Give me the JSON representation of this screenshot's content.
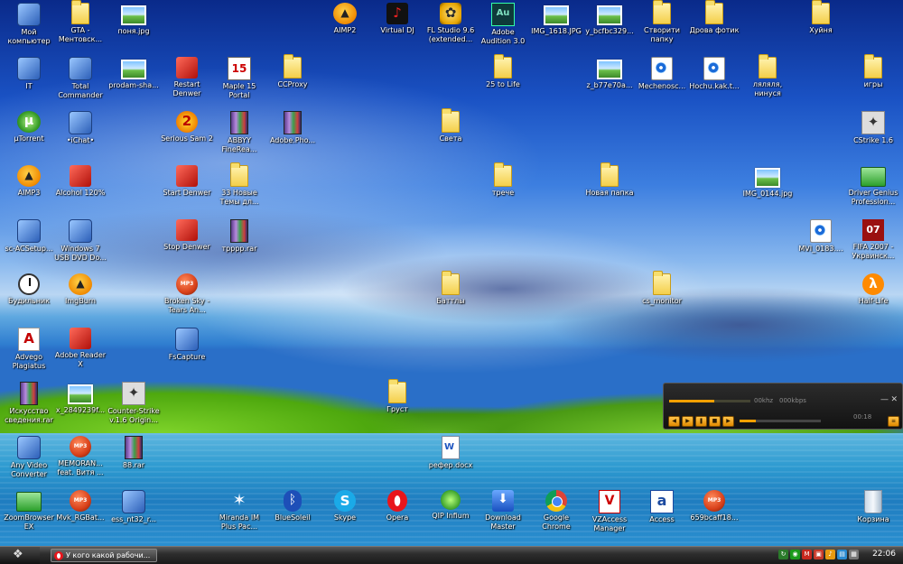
{
  "desktop_icons": [
    {
      "label": "Мой\nкомпьютер",
      "icon": "computer-icon",
      "kind": "app",
      "col": 0,
      "row": 0
    },
    {
      "label": "GTA -\nМентовск...",
      "icon": "folder-icon",
      "kind": "folder",
      "col": 1,
      "row": 0
    },
    {
      "label": "поня.jpg",
      "icon": "image-file-icon",
      "kind": "image",
      "col": 2,
      "row": 0
    },
    {
      "label": "AIMP2",
      "icon": "aimp-icon",
      "kind": "aimp",
      "col": 6,
      "row": 0
    },
    {
      "label": "Virtual DJ",
      "icon": "virtual-dj-icon",
      "kind": "dj",
      "col": 7,
      "row": 0
    },
    {
      "label": "FL Studio 9.6\n(extended...",
      "icon": "fl-studio-icon",
      "kind": "fl",
      "col": 8,
      "row": 0
    },
    {
      "label": "Adobe\nAudition 3.0",
      "icon": "adobe-audition-icon",
      "kind": "au",
      "col": 9,
      "row": 0
    },
    {
      "label": "IMG_1618.JPG",
      "icon": "image-file-icon",
      "kind": "image",
      "col": 10,
      "row": 0
    },
    {
      "label": "y_bcfbc329...",
      "icon": "image-file-icon",
      "kind": "image",
      "col": 11,
      "row": 0
    },
    {
      "label": "Створити\nпапку",
      "icon": "folder-icon",
      "kind": "folder",
      "col": 12,
      "row": 0
    },
    {
      "label": "Дрова фотик",
      "icon": "folder-icon",
      "kind": "folder",
      "col": 13,
      "row": 0
    },
    {
      "label": "Хуйня",
      "icon": "folder-icon",
      "kind": "folder",
      "col": 15,
      "row": 0
    },
    {
      "label": "IT",
      "icon": "network-computer-icon",
      "kind": "app",
      "col": 0,
      "row": 1
    },
    {
      "label": "Total\nCommander",
      "icon": "floppy-icon",
      "kind": "app",
      "col": 1,
      "row": 1
    },
    {
      "label": "prodam-sha...",
      "icon": "image-file-icon",
      "kind": "image",
      "col": 2,
      "row": 1
    },
    {
      "label": "Restart\nDenwer",
      "icon": "denwer-icon",
      "kind": "red",
      "col": 3,
      "row": 1
    },
    {
      "label": "Maple 15\nPortal",
      "icon": "maple-icon",
      "kind": "maple",
      "col": 4,
      "row": 1
    },
    {
      "label": "CCProxy",
      "icon": "folder-icon",
      "kind": "folder",
      "col": 5,
      "row": 1
    },
    {
      "label": "25 to Life",
      "icon": "folder-icon",
      "kind": "folder",
      "col": 9,
      "row": 1
    },
    {
      "label": "z_b77e70a...",
      "icon": "image-file-icon",
      "kind": "image",
      "col": 11,
      "row": 1
    },
    {
      "label": "Mechenosc...",
      "icon": "video-file-icon",
      "kind": "video",
      "col": 12,
      "row": 1
    },
    {
      "label": "Hochu.kak.t...",
      "icon": "video-file-icon",
      "kind": "video",
      "col": 13,
      "row": 1
    },
    {
      "label": "ляляля,\nнинуся",
      "icon": "folder-icon",
      "kind": "folder",
      "col": 14,
      "row": 1
    },
    {
      "label": "игры",
      "icon": "folder-icon",
      "kind": "folder",
      "col": 16,
      "row": 1
    },
    {
      "label": "µTorrent",
      "icon": "utorrent-icon",
      "kind": "utorrent",
      "col": 0,
      "row": 2
    },
    {
      "label": "•iChat•",
      "icon": "phone-icon",
      "kind": "app",
      "col": 1,
      "row": 2
    },
    {
      "label": "Serious Sam 2",
      "icon": "serious-sam-icon",
      "kind": "sam",
      "col": 3,
      "row": 2
    },
    {
      "label": "ABBYY\nFineRea...",
      "icon": "document-icon",
      "kind": "rar",
      "col": 4,
      "row": 2
    },
    {
      "label": "Adobe.Pho...",
      "icon": "archive-icon",
      "kind": "rar",
      "col": 5,
      "row": 2
    },
    {
      "label": "Света",
      "icon": "folder-icon",
      "kind": "folder",
      "col": 8,
      "row": 2
    },
    {
      "label": "CStrike 1.6",
      "icon": "counter-strike-icon",
      "kind": "cs",
      "col": 16,
      "row": 2
    },
    {
      "label": "AIMP3",
      "icon": "aimp-icon",
      "kind": "aimp",
      "col": 0,
      "row": 3
    },
    {
      "label": "Alcohol 120%",
      "icon": "alcohol-icon",
      "kind": "red",
      "col": 1,
      "row": 3
    },
    {
      "label": "Start Denwer",
      "icon": "denwer-icon",
      "kind": "red",
      "col": 3,
      "row": 3
    },
    {
      "label": "33 Новые\nТемы дл...",
      "icon": "folder-icon",
      "kind": "folder",
      "col": 4,
      "row": 3
    },
    {
      "label": "трече",
      "icon": "folder-icon",
      "kind": "folder",
      "col": 9,
      "row": 3
    },
    {
      "label": "Новая папка",
      "icon": "folder-icon",
      "kind": "folder",
      "col": 11,
      "row": 3
    },
    {
      "label": "IMG_0144.jpg",
      "icon": "image-file-icon",
      "kind": "image",
      "col": 14,
      "row": 3
    },
    {
      "label": "Driver Genius\nProfession...",
      "icon": "driver-genius-icon",
      "kind": "net",
      "col": 16,
      "row": 3
    },
    {
      "label": "sc-ACSetup...",
      "icon": "satellite-icon",
      "kind": "app",
      "col": 0,
      "row": 4
    },
    {
      "label": "Windows 7\nUSB DVD Do...",
      "icon": "usb-icon",
      "kind": "app",
      "col": 1,
      "row": 4
    },
    {
      "label": "Stop Denwer",
      "icon": "denwer-icon",
      "kind": "red",
      "col": 3,
      "row": 4
    },
    {
      "label": "трррр.rar",
      "icon": "archive-icon",
      "kind": "rar",
      "col": 4,
      "row": 4
    },
    {
      "label": "MVI_0183....",
      "icon": "video-file-icon",
      "kind": "video",
      "col": 15,
      "row": 4
    },
    {
      "label": "FIFA 2007 -\nУкраинск...",
      "icon": "fifa-icon",
      "kind": "fifa",
      "col": 16,
      "row": 4
    },
    {
      "label": "Будильник",
      "icon": "clock-icon",
      "kind": "clock",
      "col": 0,
      "row": 5
    },
    {
      "label": "ImgBurn",
      "icon": "imgburn-icon",
      "kind": "aimp",
      "col": 1,
      "row": 5
    },
    {
      "label": "Broken Sky -\nTears An...",
      "icon": "mp3-icon",
      "kind": "mp3",
      "col": 3,
      "row": 5
    },
    {
      "label": "Баттлы",
      "icon": "folder-icon",
      "kind": "folder",
      "col": 8,
      "row": 5
    },
    {
      "label": "cs_monitor",
      "icon": "folder-icon",
      "kind": "folder",
      "col": 12,
      "row": 5
    },
    {
      "label": "Half-Life",
      "icon": "half-life-icon",
      "kind": "hl",
      "col": 16,
      "row": 5
    },
    {
      "label": "Advego\nPlagiatus",
      "icon": "advego-icon",
      "kind": "adobe",
      "col": 0,
      "row": 6
    },
    {
      "label": "Adobe Reader\nX",
      "icon": "adobe-reader-icon",
      "kind": "red",
      "col": 1,
      "row": 6
    },
    {
      "label": "FsCapture",
      "icon": "fscapture-icon",
      "kind": "app",
      "col": 3,
      "row": 6
    },
    {
      "label": "Искусство\nсведения.rar",
      "icon": "archive-icon",
      "kind": "rar",
      "col": 0,
      "row": 7
    },
    {
      "label": "x_2849239f...",
      "icon": "image-file-icon",
      "kind": "image",
      "col": 1,
      "row": 7
    },
    {
      "label": "Counter-Strike\nv.1.6 Origin...",
      "icon": "counter-strike-icon",
      "kind": "cs",
      "col": 2,
      "row": 7
    },
    {
      "label": "Груст",
      "icon": "folder-icon",
      "kind": "folder",
      "col": 7,
      "row": 7
    },
    {
      "label": "Any Video\nConverter",
      "icon": "video-converter-icon",
      "kind": "app",
      "col": 0,
      "row": 8
    },
    {
      "label": "MEMORAN...\nfeat. Витя ...",
      "icon": "mp3-icon",
      "kind": "mp3",
      "col": 1,
      "row": 8
    },
    {
      "label": "88.rar",
      "icon": "archive-icon",
      "kind": "rar",
      "col": 2,
      "row": 8
    },
    {
      "label": "рефер.docx",
      "icon": "word-document-icon",
      "kind": "doc",
      "col": 8,
      "row": 8
    },
    {
      "label": "ZoomBrowser\nEX",
      "icon": "zoombrowser-icon",
      "kind": "net",
      "col": 0,
      "row": 9
    },
    {
      "label": "Mvk_RGBat...",
      "icon": "mp3-icon",
      "kind": "mp3",
      "col": 1,
      "row": 9
    },
    {
      "label": "ess_nt32_r...",
      "icon": "installer-icon",
      "kind": "app",
      "col": 2,
      "row": 9
    },
    {
      "label": "Miranda IM\nPlus Pac...",
      "icon": "miranda-icon",
      "kind": "miranda",
      "col": 4,
      "row": 9
    },
    {
      "label": "BlueSoleil",
      "icon": "bluetooth-icon",
      "kind": "bt",
      "col": 5,
      "row": 9
    },
    {
      "label": "Skype",
      "icon": "skype-icon",
      "kind": "skype",
      "col": 6,
      "row": 9
    },
    {
      "label": "Opera",
      "icon": "opera-icon",
      "kind": "opera",
      "col": 7,
      "row": 9
    },
    {
      "label": "QIP Infium",
      "icon": "qip-icon",
      "kind": "qip",
      "col": 8,
      "row": 9
    },
    {
      "label": "Download\nMaster",
      "icon": "download-master-icon",
      "kind": "dl",
      "col": 9,
      "row": 9
    },
    {
      "label": "Google\nChrome",
      "icon": "chrome-icon",
      "kind": "chrome",
      "col": 10,
      "row": 9
    },
    {
      "label": "VZAccess\nManager",
      "icon": "vzaccess-icon",
      "kind": "vz",
      "col": 11,
      "row": 9
    },
    {
      "label": "Access",
      "icon": "access-icon",
      "kind": "access",
      "col": 12,
      "row": 9
    },
    {
      "label": "659bcaff18...",
      "icon": "mp3-icon",
      "kind": "mp3",
      "col": 13,
      "row": 9
    },
    {
      "label": "Корзина",
      "icon": "recycle-bin-icon",
      "kind": "bin",
      "col": 16,
      "row": 9
    }
  ],
  "player": {
    "bitrate_khz": "00khz",
    "bitrate_kbps": "000kbps",
    "time": "00:18",
    "progress": 0.2,
    "accent": "#f7a000"
  },
  "taskbar": {
    "start_icon": "windows-logo-icon",
    "task_title": "У кого какой рабочи...",
    "task_icon": "opera-icon",
    "clock": "22:06",
    "tray_icons": [
      "refresh-icon",
      "network-icon",
      "gmail-icon",
      "tray-app-icon",
      "volume-icon",
      "tray-app-icon-2",
      "tray-app-icon-3"
    ]
  }
}
